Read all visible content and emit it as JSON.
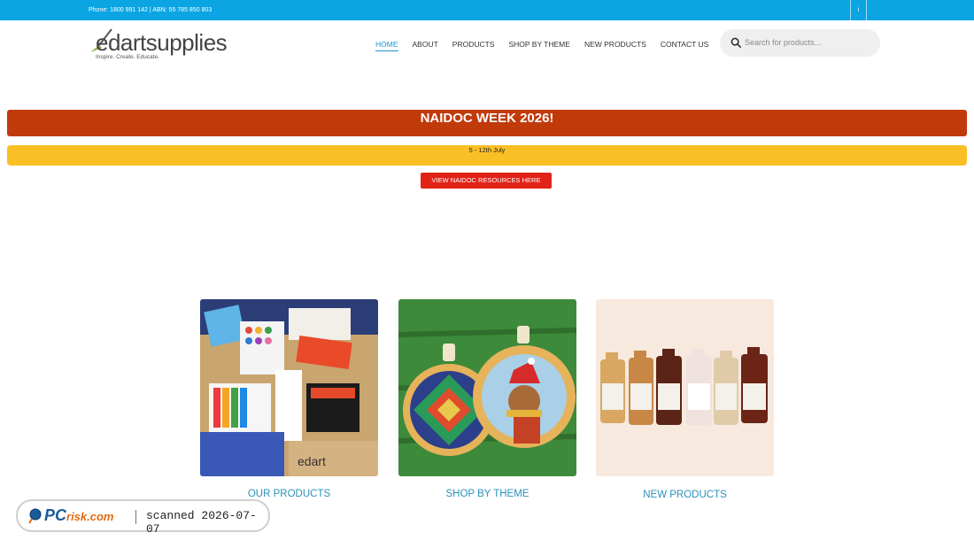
{
  "topbar": {
    "contact": "Phone: 1800 991 142 | ABN: 55 785 850 803",
    "social_glyph": "i"
  },
  "header": {
    "logo_brand": "edartsupplies",
    "logo_tagline": "Inspire. Create. Educate.",
    "nav": [
      {
        "label": "HOME",
        "active": true
      },
      {
        "label": "ABOUT"
      },
      {
        "label": "PRODUCTS"
      },
      {
        "label": "SHOP BY THEME"
      },
      {
        "label": "NEW PRODUCTS"
      },
      {
        "label": "CONTACT US"
      }
    ],
    "search_placeholder": "Search for products..."
  },
  "promo": {
    "title": "NAIDOC WEEK 2026!",
    "dates": "5 - 12th July",
    "button": "VIEW NAIDOC RESOURCES HERE"
  },
  "cards": [
    {
      "label": "OUR PRODUCTS"
    },
    {
      "label": "SHOP BY THEME"
    },
    {
      "label": "NEW PRODUCTS"
    }
  ],
  "watermark": {
    "logo_pc": "PC",
    "logo_risk": "risk.com",
    "scan_text": "scanned 2026-07-07"
  },
  "colors": {
    "topbar": "#0ba5e3",
    "banner_red": "#c13a0a",
    "banner_yellow": "#fbbf26",
    "button_red": "#e02316",
    "link_teal": "#2a92b9"
  }
}
